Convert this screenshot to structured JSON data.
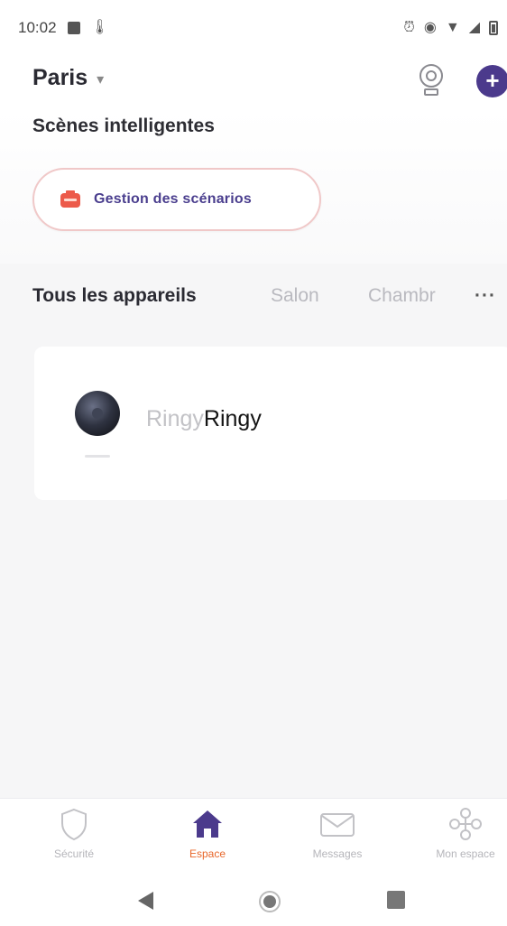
{
  "status_bar": {
    "time": "10:02",
    "icons_left": [
      "notification-square-icon",
      "thermometer-icon"
    ],
    "icons_right": [
      "alarm-icon",
      "eye-icon",
      "wifi-icon",
      "signal-icon",
      "battery-icon"
    ]
  },
  "header": {
    "location": "Paris",
    "location_dropdown_icon": "chevron-down-icon",
    "camera_icon": "camera-icon",
    "add_icon": "plus-icon"
  },
  "scenes": {
    "title": "Scènes intelligentes",
    "manage_button_label": "Gestion des scénarios",
    "manage_button_icon": "scenario-icon"
  },
  "tabs": [
    {
      "label": "Tous les appareils",
      "active": true
    },
    {
      "label": "Salon",
      "active": false
    },
    {
      "label": "Chambr",
      "active": false
    }
  ],
  "tabs_more": "···",
  "devices": [
    {
      "name_ghost": "Ringy",
      "name": "Ringy",
      "icon": "doorbell-camera-icon"
    }
  ],
  "bottom_nav": [
    {
      "label": "Sécurité",
      "icon": "shield-icon",
      "active": false
    },
    {
      "label": "Espace",
      "icon": "home-icon",
      "active": true
    },
    {
      "label": "Messages",
      "icon": "mail-icon",
      "active": false
    },
    {
      "label": "Mon espace",
      "icon": "profile-nodes-icon",
      "active": false
    }
  ],
  "system_nav": {
    "back_icon": "back-icon",
    "home_icon": "home-circle-icon",
    "recents_icon": "recents-icon"
  },
  "colors": {
    "accent_purple": "#4b3a8c",
    "active_orange": "#e8672a",
    "button_border": "#f0c8c8",
    "background": "#f6f6f7"
  }
}
